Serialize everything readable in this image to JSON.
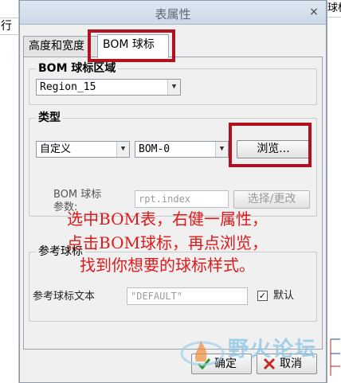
{
  "background": {
    "left_text": "行",
    "right_text": "球标"
  },
  "dialog": {
    "title": "表属性",
    "close_glyph": "×"
  },
  "tabs": [
    {
      "label": "高度和宽度",
      "active": false
    },
    {
      "label": "BOM 球标",
      "active": true
    }
  ],
  "bom_region": {
    "label": "BOM 球标区域",
    "value": "Region_15"
  },
  "type_group": {
    "label": "类型",
    "type_value": "自定义",
    "bom_value": "BOM-0",
    "browse_label": "浏览...",
    "param_label_line1": "BOM 球标",
    "param_label_line2": "参数:",
    "param_value": "rpt.index",
    "select_change_label": "选择/更改"
  },
  "ref_group": {
    "label": "参考球标",
    "text_label": "参考球标文本",
    "text_value": "\"DEFAULT\"",
    "default_label": "默认",
    "default_checked": true
  },
  "overlay_text": [
    "选中BOM表，右健一属性，",
    "点击BOM球标，再点浏览，",
    "找到你想要的球标样式。"
  ],
  "watermark": {
    "text": "野火论坛"
  },
  "buttons": {
    "ok": "确定",
    "cancel": "取消"
  },
  "colors": {
    "highlight": "#b21220",
    "overlay_text": "#e01a1a",
    "ok_icon": "#2e9a2e",
    "cancel_icon": "#c62828"
  }
}
